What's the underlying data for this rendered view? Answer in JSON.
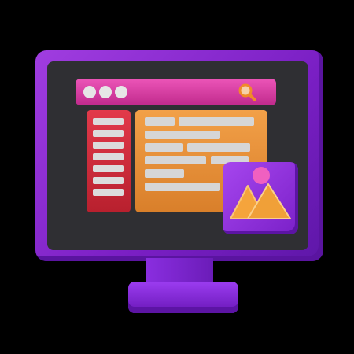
{
  "illustration": {
    "subject": "monitor-with-web-page",
    "colors": {
      "frame": "#8a2ee0",
      "screen": "#2f2f33",
      "address_bar": "#e04aae",
      "sidebar": "#d22e3e",
      "content_panel": "#e8903a",
      "image_card": "#9036dc",
      "placeholder_bar": "#d6d6d6"
    },
    "icons": [
      "window-dots-icon",
      "search-icon",
      "image-icon"
    ]
  }
}
